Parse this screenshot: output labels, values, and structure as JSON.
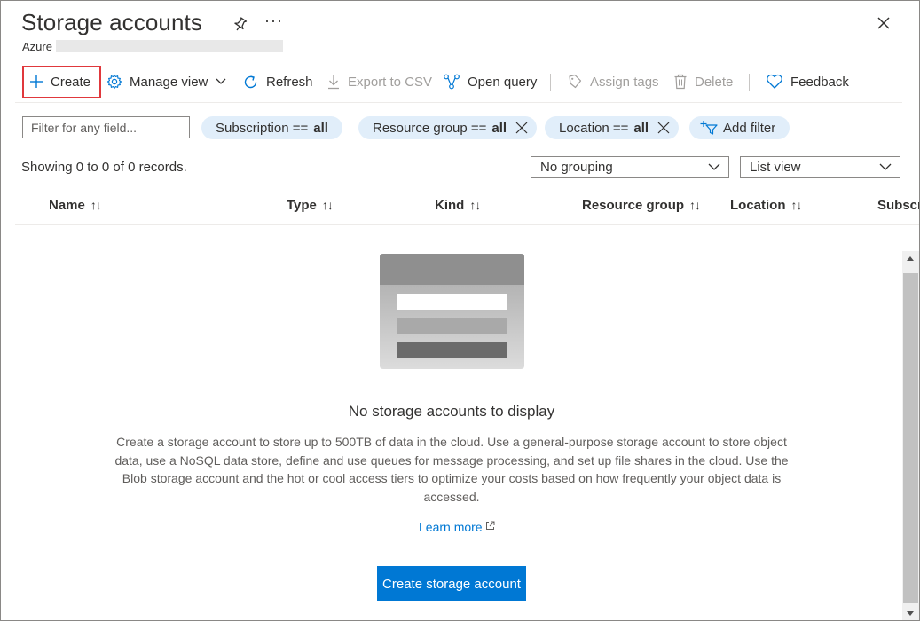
{
  "page": {
    "title": "Storage accounts",
    "subtitle": "Azure",
    "more_glyph": "···"
  },
  "toolbar": {
    "create": "Create",
    "manage_view": "Manage view",
    "refresh": "Refresh",
    "export_csv": "Export to CSV",
    "open_query": "Open query",
    "assign_tags": "Assign tags",
    "delete": "Delete",
    "feedback": "Feedback"
  },
  "filters": {
    "search_placeholder": "Filter for any field...",
    "subscription_label": "Subscription ==",
    "subscription_value": "all",
    "resource_group_label": "Resource group ==",
    "resource_group_value": "all",
    "location_label": "Location ==",
    "location_value": "all",
    "add_filter": "Add filter"
  },
  "records_text": "Showing 0 to 0 of 0 records.",
  "grouping": {
    "selected": "No grouping"
  },
  "view_mode": {
    "selected": "List view"
  },
  "columns": [
    "Name",
    "Type",
    "Kind",
    "Resource group",
    "Location",
    "Subscri"
  ],
  "empty_state": {
    "title": "No storage accounts to display",
    "description": "Create a storage account to store up to 500TB of data in the cloud. Use a general-purpose storage account to store object data, use a NoSQL data store, define and use queues for message processing, and set up file shares in the cloud. Use the Blob storage account and the hot or cool access tiers to optimize your costs based on how frequently your object data is accessed.",
    "learn_more": "Learn more",
    "cta": "Create storage account"
  },
  "colors": {
    "accent": "#0078d4",
    "pill_bg": "#e1eefa",
    "highlight_border": "#e0383c"
  },
  "icons": [
    "pin-icon",
    "more-icon",
    "close-icon",
    "plus-icon",
    "gear-icon",
    "chevron-down-icon",
    "refresh-icon",
    "download-icon",
    "query-icon",
    "tag-icon",
    "trash-icon",
    "heart-icon",
    "dismiss-icon",
    "add-filter-icon",
    "sort-icon",
    "external-link-icon",
    "storage-illustration"
  ]
}
